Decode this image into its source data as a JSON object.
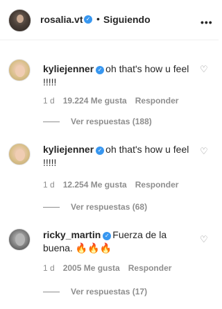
{
  "header": {
    "username": "rosalia.vt",
    "separator": "•",
    "follow_status": "Siguiendo",
    "more": "•••"
  },
  "icons": {
    "verified": "verified-badge-icon",
    "heart": "heart-outline-icon",
    "more": "more-options-icon"
  },
  "comments": [
    {
      "username": "kyliejenner",
      "text": "oh that's how u feel !!!!!",
      "time": "1 d",
      "likes": "19.224 Me gusta",
      "reply": "Responder",
      "view_replies": "Ver respuestas (188)"
    },
    {
      "username": "kyliejenner",
      "text": "oh that's how u feel !!!!!",
      "time": "1 d",
      "likes": "12.254 Me gusta",
      "reply": "Responder",
      "view_replies": "Ver respuestas (68)"
    },
    {
      "username": "ricky_martin",
      "text": "Fuerza de la buena. 🔥🔥🔥",
      "time": "1 d",
      "likes": "2005 Me gusta",
      "reply": "Responder",
      "view_replies": "Ver respuestas (17)"
    }
  ],
  "colors": {
    "verified": "#3897f0",
    "text": "#262626",
    "secondary": "#8e8e8e",
    "divider": "#efefef"
  }
}
